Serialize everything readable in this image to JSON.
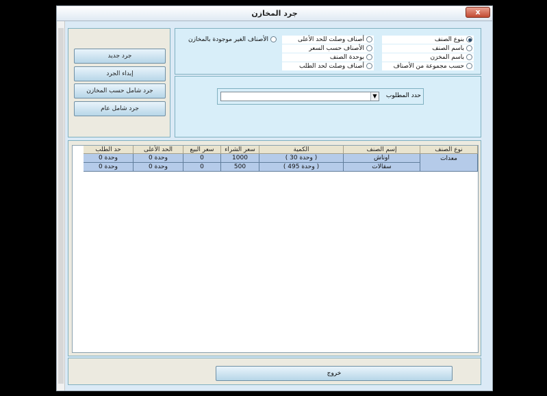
{
  "window": {
    "title": "جرد المخازن",
    "close_label": "x"
  },
  "actions": [
    {
      "label": "جرد جديد"
    },
    {
      "label": "إبداء الجرد"
    },
    {
      "label": "جرد شامل حسب المخازن"
    },
    {
      "label": "جرد شامل عام"
    }
  ],
  "filters": {
    "col1": [
      {
        "label": "بنوع الصنف",
        "selected": true
      },
      {
        "label": "باسم الصنف",
        "selected": false
      },
      {
        "label": "باسم المخزن",
        "selected": false
      },
      {
        "label": "حسب مجموعة من الأصناف",
        "selected": false
      }
    ],
    "col2": [
      {
        "label": "أصناف وصلت للحد الأعلى",
        "selected": false
      },
      {
        "label": "الأصناف حسب السعر",
        "selected": false
      },
      {
        "label": "بوحدة الصنف",
        "selected": false
      },
      {
        "label": "أصناف وصلت لحد الطلب",
        "selected": false
      }
    ],
    "col3": [
      {
        "label": "الأصناف الغير موجودة بالمخازن",
        "selected": false
      }
    ]
  },
  "selector": {
    "label": "حدد المطلوب",
    "value": ""
  },
  "grid": {
    "headers": [
      "نوع الصنف",
      "إسم الصنف",
      "الكمية",
      "سعر الشراء",
      "سعر البيع",
      "الحد الأعلى",
      "حد الطلب"
    ],
    "group": "معدات",
    "rows": [
      [
        "اوناش",
        "( 30 وحدة )",
        "1000",
        "0",
        "0 وحدة",
        "0 وحدة"
      ],
      [
        "سقالات",
        "( 495 وحدة )",
        "500",
        "0",
        "0 وحدة",
        "0 وحدة"
      ]
    ]
  },
  "exit_label": "خروج"
}
